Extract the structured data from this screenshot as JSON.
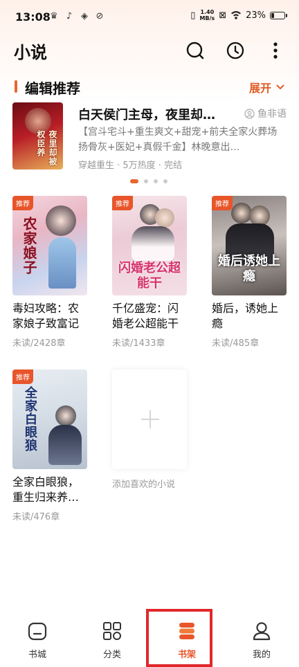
{
  "status_bar": {
    "time": "13:08",
    "net_speed_value": "1.40",
    "net_speed_unit": "MB/s",
    "battery": "23%",
    "battery_level": 0.23
  },
  "header": {
    "title": "小说",
    "search_icon": "search-icon",
    "history_icon": "clock-icon",
    "more_icon": "more-vertical-icon"
  },
  "section": {
    "title": "编辑推荐",
    "expand_label": "展开",
    "accent": "#e8662f"
  },
  "featured": {
    "title": "白天侯门主母，夜里却…",
    "author": "鱼非语",
    "description": "【宫斗宅斗+重生爽文+甜宠+前夫全家火葬场扬骨灰+医妃+真假千金】林晚意出…",
    "meta": "穿越重生 · 5万热度 · 完结",
    "cover_text": "夜里却被权臣养"
  },
  "carousel": {
    "count": 4,
    "active_index": 0
  },
  "books": [
    {
      "badge": "推荐",
      "title": "毒妇攻略：农家娘子致富记",
      "meta": "未读/2428章",
      "cover_text": "农家娘子"
    },
    {
      "badge": "推荐",
      "title": "千亿盛宠：闪婚老公超能干",
      "meta": "未读/1433章",
      "cover_text": "闪婚老公超能干"
    },
    {
      "badge": "推荐",
      "title": "婚后，诱她上瘾",
      "meta": "未读/485章",
      "cover_text": "婚后诱她上瘾"
    },
    {
      "badge": "推荐",
      "title": "全家白眼狼，重生归来养…",
      "meta": "未读/476章",
      "cover_text": "全家白眼狼"
    }
  ],
  "add_book": {
    "label": "添加喜欢的小说"
  },
  "bottom_nav": {
    "items": [
      {
        "label": "书城",
        "icon": "bookstore-icon"
      },
      {
        "label": "分类",
        "icon": "category-grid-icon"
      },
      {
        "label": "书架",
        "icon": "bookshelf-icon"
      },
      {
        "label": "我的",
        "icon": "profile-icon"
      }
    ],
    "active_index": 2,
    "active_color": "#e8552a"
  }
}
